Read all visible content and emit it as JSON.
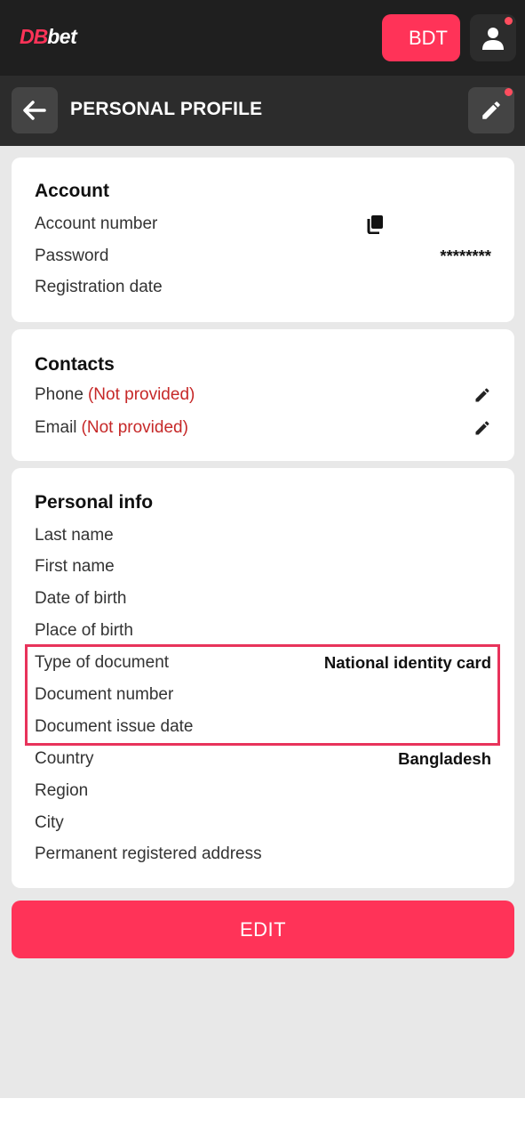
{
  "header": {
    "logo_prefix": "DB",
    "logo_suffix": "bet",
    "currency_label": "BDT",
    "user_icon": "user-icon",
    "notification_color": "#ff4d5e"
  },
  "subheader": {
    "title": "PERSONAL PROFILE",
    "back_icon": "arrow-left-icon",
    "edit_icon": "pencil-icon"
  },
  "account": {
    "title": "Account",
    "rows": [
      {
        "label": "Account number",
        "icon": "copy-icon"
      },
      {
        "label": "Password",
        "value": "********"
      },
      {
        "label": "Registration date"
      }
    ]
  },
  "contacts": {
    "title": "Contacts",
    "rows": [
      {
        "label": "Phone",
        "status": "(Not provided)",
        "icon": "pencil-icon"
      },
      {
        "label": "Email",
        "status": "(Not provided)",
        "icon": "pencil-icon"
      }
    ]
  },
  "personal_info": {
    "title": "Personal info",
    "rows": [
      {
        "label": "Last name"
      },
      {
        "label": "First name"
      },
      {
        "label": "Date of birth"
      },
      {
        "label": "Place of birth"
      },
      {
        "label": "Type of document",
        "value": "National identity card"
      },
      {
        "label": "Document number"
      },
      {
        "label": "Document issue date"
      },
      {
        "label": "Country",
        "value": "Bangladesh"
      },
      {
        "label": "Region"
      },
      {
        "label": "City"
      },
      {
        "label": "Permanent registered address"
      }
    ]
  },
  "actions": {
    "edit_label": "EDIT"
  },
  "colors": {
    "accent": "#ff3358",
    "not_provided": "#c62828",
    "highlight_border": "#e8335b"
  }
}
